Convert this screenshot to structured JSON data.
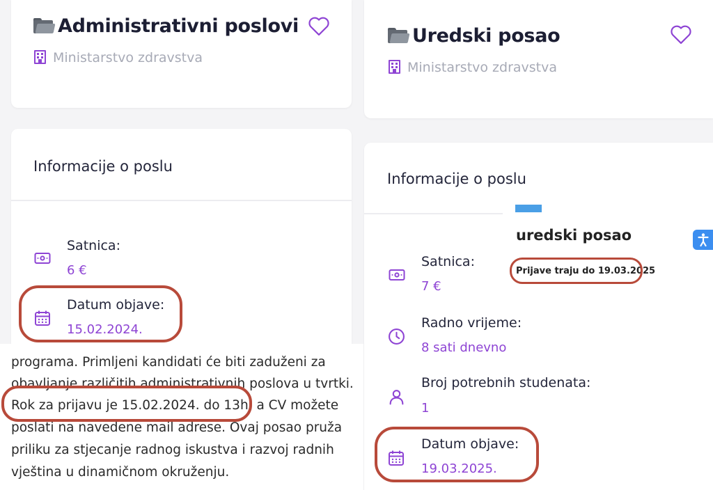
{
  "left": {
    "header": {
      "title": "Administrativni poslovi",
      "company": "Ministarstvo zdravstva"
    },
    "info_title": "Informacije o poslu",
    "fields": [
      {
        "label": "Satnica:",
        "value": "6 €"
      },
      {
        "label": "Datum objave:",
        "value": "15.02.2024."
      }
    ],
    "description_lines": [
      "programa. Primljeni kandidati će biti zaduženi za",
      "obavljanje različitih administrativnih poslova u tvrtki.",
      "Rok za prijavu je 15.02.2024. do 13h, a CV možete",
      "poslati na navedene mail adrese. Ovaj posao pruža",
      "priliku za stjecanje radnog iskustva i razvoj radnih",
      "vještina u dinamičnom okruženju."
    ]
  },
  "right": {
    "header": {
      "title": "Uredski posao",
      "company": "Ministarstvo zdravstva"
    },
    "info_title": "Informacije o poslu",
    "fields": [
      {
        "label": "Satnica:",
        "value": "7 €"
      },
      {
        "label": "Radno vrijeme:",
        "value": "8 sati dnevno"
      },
      {
        "label": "Broj potrebnih studenata:",
        "value": "1"
      },
      {
        "label": "Datum objave:",
        "value": "19.03.2025."
      }
    ],
    "popup": {
      "title": "uredski posao",
      "subtitle": "Prijave traju do 19.03.2025"
    }
  },
  "colors": {
    "accent": "#8e44d4",
    "highlight": "#b84a3a",
    "widget": "#3b8ef0"
  },
  "icons": [
    "folder-icon",
    "building-icon",
    "heart-icon",
    "money-icon",
    "calendar-icon",
    "clock-icon",
    "user-icon",
    "accessibility-icon"
  ]
}
